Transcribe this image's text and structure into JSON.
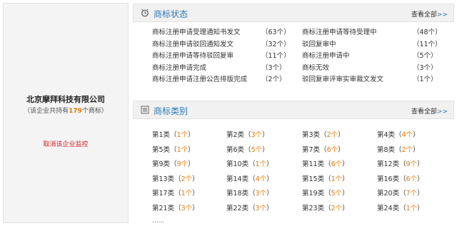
{
  "company": {
    "name": "北京摩拜科技有限公司",
    "count_prefix": "（该企业共持有",
    "count": "179",
    "count_suffix": "个商标）",
    "cancel_monitor": "取消该企业监控"
  },
  "status_panel": {
    "title": "商标状态",
    "more": "查看全部",
    "more_arrow": ">>",
    "rows": [
      {
        "left_label": "商标注册申请受理通知书发文",
        "left_count": "（63个）",
        "right_label": "商标注册申请等待受理中",
        "right_count": "（48个）"
      },
      {
        "left_label": "商标注册申请驳回通知发文",
        "left_count": "（32个）",
        "right_label": "驳回复审中",
        "right_count": "（11个）"
      },
      {
        "left_label": "商标注册申请等待驳回复审",
        "left_count": "（11个）",
        "right_label": "商标注册申请中",
        "right_count": "（5个）"
      },
      {
        "left_label": "商标注册申请完成",
        "left_count": "（3个）",
        "right_label": "商标无效",
        "right_count": "（3个）"
      },
      {
        "left_label": "商标注册申请注册公告排版完成",
        "left_count": "（2个）",
        "right_label": "驳回复审评审实审裁文发文",
        "right_count": "（1个）"
      }
    ]
  },
  "category_panel": {
    "title": "商标类别",
    "more": "查看全部",
    "more_arrow": ">>",
    "rows": [
      [
        {
          "cls": "第1类",
          "n": "1个"
        },
        {
          "cls": "第2类",
          "n": "3个"
        },
        {
          "cls": "第3类",
          "n": "2个"
        },
        {
          "cls": "第4类",
          "n": "4个"
        }
      ],
      [
        {
          "cls": "第5类",
          "n": "1个"
        },
        {
          "cls": "第6类",
          "n": "5个"
        },
        {
          "cls": "第7类",
          "n": "6个"
        },
        {
          "cls": "第8类",
          "n": "2个"
        }
      ],
      [
        {
          "cls": "第9类",
          "n": "9个"
        },
        {
          "cls": "第10类",
          "n": "1个"
        },
        {
          "cls": "第11类",
          "n": "6个"
        },
        {
          "cls": "第12类",
          "n": "9个"
        }
      ],
      [
        {
          "cls": "第13类",
          "n": "2个"
        },
        {
          "cls": "第14类",
          "n": "4个"
        },
        {
          "cls": "第15类",
          "n": "1个"
        },
        {
          "cls": "第16类",
          "n": "6个"
        }
      ],
      [
        {
          "cls": "第17类",
          "n": "1个"
        },
        {
          "cls": "第18类",
          "n": "3个"
        },
        {
          "cls": "第19类",
          "n": "5个"
        },
        {
          "cls": "第20类",
          "n": "7个"
        }
      ],
      [
        {
          "cls": "第21类",
          "n": "3个"
        },
        {
          "cls": "第22类",
          "n": "3个"
        },
        {
          "cls": "第23类",
          "n": "2个"
        },
        {
          "cls": "第24类",
          "n": "1个"
        }
      ]
    ],
    "ellipsis": "......"
  },
  "icons": {
    "status": "alarm-clock-icon",
    "category": "list-icon"
  },
  "colors": {
    "title_blue": "#2a7ab8",
    "count_orange": "#e87a00",
    "cancel_red": "#cc2222"
  }
}
